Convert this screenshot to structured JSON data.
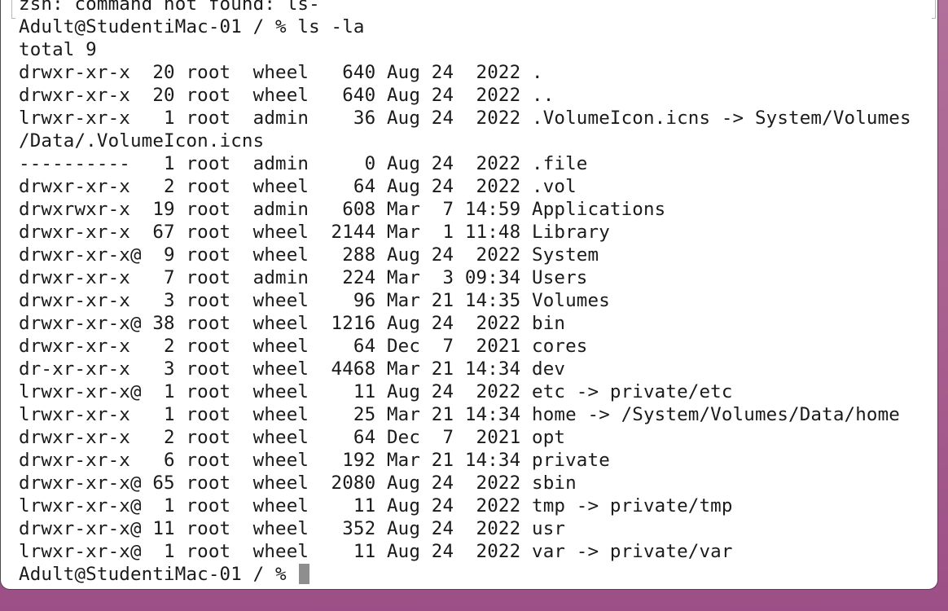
{
  "terminal": {
    "lines": [
      "zsh: command not found: ls-",
      "Adult@StudentiMac-01 / % ls -la",
      "total 9",
      "drwxr-xr-x  20 root  wheel   640 Aug 24  2022 .",
      "drwxr-xr-x  20 root  wheel   640 Aug 24  2022 ..",
      "lrwxr-xr-x   1 root  admin    36 Aug 24  2022 .VolumeIcon.icns -> System/Volumes",
      "/Data/.VolumeIcon.icns",
      "----------   1 root  admin     0 Aug 24  2022 .file",
      "drwxr-xr-x   2 root  wheel    64 Aug 24  2022 .vol",
      "drwxrwxr-x  19 root  admin   608 Mar  7 14:59 Applications",
      "drwxr-xr-x  67 root  wheel  2144 Mar  1 11:48 Library",
      "drwxr-xr-x@  9 root  wheel   288 Aug 24  2022 System",
      "drwxr-xr-x   7 root  admin   224 Mar  3 09:34 Users",
      "drwxr-xr-x   3 root  wheel    96 Mar 21 14:35 Volumes",
      "drwxr-xr-x@ 38 root  wheel  1216 Aug 24  2022 bin",
      "drwxr-xr-x   2 root  wheel    64 Dec  7  2021 cores",
      "dr-xr-xr-x   3 root  wheel  4468 Mar 21 14:34 dev",
      "lrwxr-xr-x@  1 root  wheel    11 Aug 24  2022 etc -> private/etc",
      "lrwxr-xr-x   1 root  wheel    25 Mar 21 14:34 home -> /System/Volumes/Data/home",
      "drwxr-xr-x   2 root  wheel    64 Dec  7  2021 opt",
      "drwxr-xr-x   6 root  wheel   192 Mar 21 14:34 private",
      "drwxr-xr-x@ 65 root  wheel  2080 Aug 24  2022 sbin",
      "lrwxr-xr-x@  1 root  wheel    11 Aug 24  2022 tmp -> private/tmp",
      "drwxr-xr-x@ 11 root  wheel   352 Aug 24  2022 usr",
      "lrwxr-xr-x@  1 root  wheel    11 Aug 24  2022 var -> private/var"
    ],
    "prompt": "Adult@StudentiMac-01 / % "
  }
}
